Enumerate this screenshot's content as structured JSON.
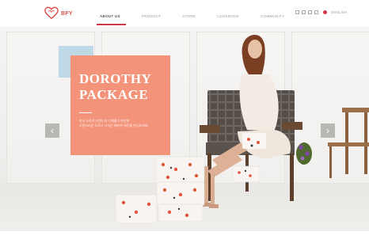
{
  "brand": {
    "name": "BFY",
    "accent": "#d0354a"
  },
  "nav": {
    "items": [
      "ABOUT US",
      "PRODUCT",
      "STORE",
      "LOOKBOOK",
      "COMMUNITY"
    ],
    "active_index": 0
  },
  "util": {
    "language_label": "ENGLISH"
  },
  "hero": {
    "title_line1": "DOROTHY",
    "title_line2": "PACKAGE",
    "desc_line1": "한국 오로라 브랜드의 다채롭고 편안한",
    "desc_line2": "사랑스러운 도로시 디자인 패키지 세트를 만나보세요",
    "promo_color": "#f2937a",
    "accent_square_color": "#bfd8e6"
  },
  "carousel": {
    "prev_icon": "‹",
    "next_icon": "›"
  }
}
